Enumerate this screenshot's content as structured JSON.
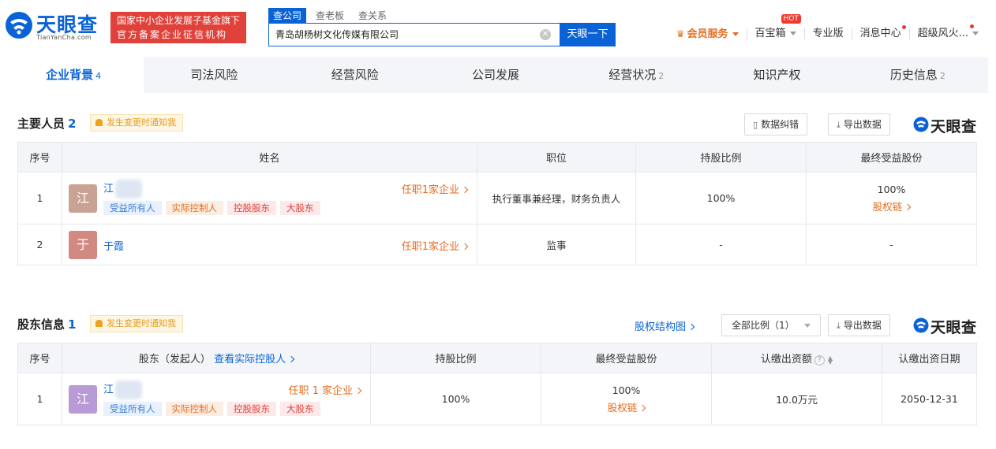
{
  "header": {
    "logo_text": "天眼查",
    "logo_sub": "TianYanCha.com",
    "badge_line1": "国家中小企业发展子基金旗下",
    "badge_line2": "官方备案企业征信机构",
    "search_tabs": [
      "查公司",
      "查老板",
      "查关系"
    ],
    "search_value": "青岛胡杨树文化传媒有限公司",
    "search_button": "天眼一下",
    "nav": {
      "vip": "会员服务",
      "baibaoxiang": "百宝箱",
      "hot": "HOT",
      "pro": "专业版",
      "messages": "消息中心",
      "user": "超级风火..."
    }
  },
  "section_tabs": [
    {
      "label": "企业背景",
      "count": "4"
    },
    {
      "label": "司法风险",
      "count": ""
    },
    {
      "label": "经营风险",
      "count": ""
    },
    {
      "label": "公司发展",
      "count": ""
    },
    {
      "label": "经营状况",
      "count": "2"
    },
    {
      "label": "知识产权",
      "count": ""
    },
    {
      "label": "历史信息",
      "count": "2"
    }
  ],
  "personnel": {
    "title": "主要人员",
    "count": "2",
    "notify": "发生变更时通知我",
    "correct_btn": "数据纠错",
    "export_btn": "导出数据",
    "brand": "天眼查",
    "columns": [
      "序号",
      "姓名",
      "职位",
      "持股比例",
      "最终受益股份"
    ],
    "rows": [
      {
        "index": "1",
        "avatar": "江",
        "name": "江",
        "job": "任职1家企业",
        "tags": [
          "受益所有人",
          "实际控制人",
          "控股股东",
          "大股东"
        ],
        "position": "执行董事兼经理，财务负责人",
        "ratio": "100%",
        "benefit": "100%",
        "benefit_link": "股权链"
      },
      {
        "index": "2",
        "avatar": "于",
        "name": "于霞",
        "job": "任职1家企业",
        "position": "监事",
        "ratio": "-",
        "benefit": "-"
      }
    ]
  },
  "shareholders": {
    "title": "股东信息",
    "count": "1",
    "notify": "发生变更时通知我",
    "structure_link": "股权结构图",
    "filter": "全部比例（1）",
    "export_btn": "导出数据",
    "brand": "天眼查",
    "columns": [
      "序号",
      "股东（发起人）",
      "查看实际控股人",
      "持股比例",
      "最终受益股份",
      "认缴出资额",
      "认缴出资日期"
    ],
    "rows": [
      {
        "index": "1",
        "avatar": "江",
        "name": "江",
        "job": "任职 1 家企业",
        "tags": [
          "受益所有人",
          "实际控制人",
          "控股股东",
          "大股东"
        ],
        "ratio": "100%",
        "benefit": "100%",
        "benefit_link": "股权链",
        "amount": "10.0万元",
        "date": "2050-12-31"
      }
    ]
  },
  "colors": {
    "brand_blue": "#0a63d6",
    "accent_orange": "#e66b1e",
    "badge_red": "#e0413a",
    "avatar_jiang": "#c9a293",
    "avatar_yu": "#d08a82",
    "avatar_jiang_2": "#b89ad6"
  }
}
